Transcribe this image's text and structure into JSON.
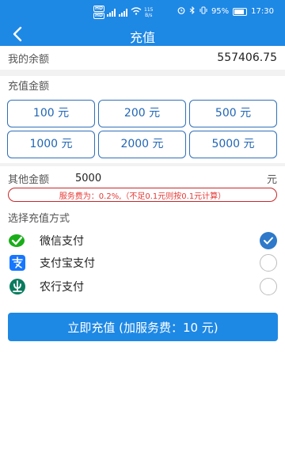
{
  "status_bar": {
    "hd1": "HD",
    "hd2": "HD",
    "net_speed_value": "115",
    "net_speed_unit": "B/s",
    "battery": "95%",
    "time": "17:30"
  },
  "header": {
    "title": "充值",
    "back_icon": "chevron-left-icon"
  },
  "balance": {
    "label": "我的余额",
    "value": "557406.75"
  },
  "amount_section": {
    "label": "充值金额",
    "options": [
      "100 元",
      "200 元",
      "500 元",
      "1000 元",
      "2000 元",
      "5000 元"
    ]
  },
  "other_amount": {
    "label": "其他金额",
    "value": "5000",
    "unit": "元"
  },
  "fee_note": "服务费为：0.2%,（不足0.1元则按0.1元计算）",
  "payment": {
    "label": "选择充值方式",
    "methods": [
      {
        "label": "微信支付",
        "icon": "wechat-pay-icon",
        "selected": true
      },
      {
        "label": "支付宝支付",
        "icon": "alipay-icon",
        "selected": false
      },
      {
        "label": "农行支付",
        "icon": "abc-bank-icon",
        "selected": false
      }
    ]
  },
  "submit_label": "立即充值 (加服务费：10 元)",
  "colors": {
    "primary": "#1e88e5",
    "button_border": "#2f6fb8",
    "fee_text": "#e53935",
    "wechat_green": "#1aad19",
    "alipay_blue": "#1677ff",
    "abc_green": "#0a7b5e"
  }
}
